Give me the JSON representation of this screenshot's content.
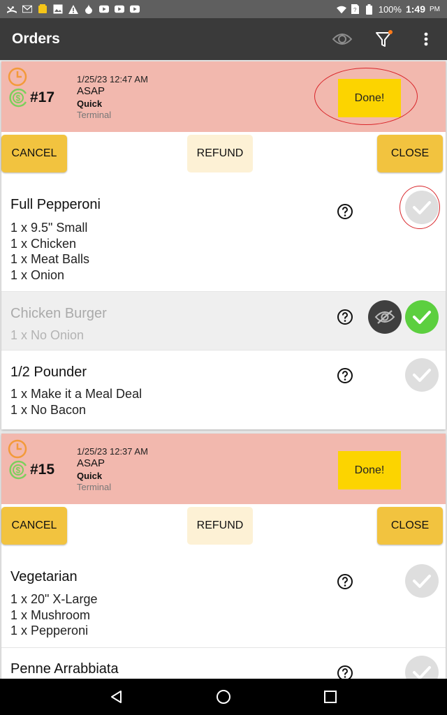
{
  "status_bar": {
    "battery": "100%",
    "time": "1:49",
    "ampm": "PM",
    "icons": [
      "missed-call-icon",
      "gmail-icon",
      "notification-icon",
      "image-icon",
      "warning-icon",
      "drop-icon",
      "youtube-icon",
      "youtube-icon",
      "youtube-icon",
      "wifi-icon",
      "sim-icon",
      "battery-icon"
    ]
  },
  "app_bar": {
    "title": "Orders",
    "actions": [
      "eye-icon",
      "filter-icon",
      "more-vert-icon"
    ],
    "filter_badge_color": "#ff7a1a"
  },
  "colors": {
    "header_bg": "#f2b8ae",
    "done_bg": "#fcd400",
    "action_bg": "#f2c33f",
    "refund_bg": "#fdf1d5",
    "clock_color": "#f39a3a",
    "dollar_color": "#7ccf5c",
    "check_on": "#5ccf3f",
    "annotation": "#d9252a"
  },
  "orders": [
    {
      "number": "#17",
      "datetime": "1/25/23 12:47 AM",
      "timing": "ASAP",
      "type": "Quick",
      "source": "Terminal",
      "done_label": "Done!",
      "cancel_label": "CANCEL",
      "refund_label": "REFUND",
      "close_label": "CLOSE",
      "items": [
        {
          "name": "Full Pepperoni",
          "mods": [
            "1 x 9.5\" Small",
            "1 x Chicken",
            "1 x Meat Balls",
            "1 x Onion"
          ],
          "checked": false,
          "hidden": false
        },
        {
          "name": "Chicken Burger",
          "mods": [
            "1 x No Onion"
          ],
          "checked": true,
          "hidden": true
        },
        {
          "name": "1/2 Pounder",
          "mods": [
            "1 x Make it a Meal Deal",
            "1 x No Bacon"
          ],
          "checked": false,
          "hidden": false
        }
      ]
    },
    {
      "number": "#15",
      "datetime": "1/25/23 12:37 AM",
      "timing": "ASAP",
      "type": "Quick",
      "source": "Terminal",
      "done_label": "Done!",
      "cancel_label": "CANCEL",
      "refund_label": "REFUND",
      "close_label": "CLOSE",
      "items": [
        {
          "name": "Vegetarian",
          "mods": [
            "1 x 20\" X-Large",
            "1 x Mushroom",
            "1 x Pepperoni"
          ],
          "checked": false,
          "hidden": false
        },
        {
          "name": "Penne Arrabbiata",
          "mods": [],
          "checked": false,
          "hidden": false
        }
      ]
    }
  ],
  "nav_bar": [
    "back-icon",
    "home-icon",
    "recents-icon"
  ]
}
